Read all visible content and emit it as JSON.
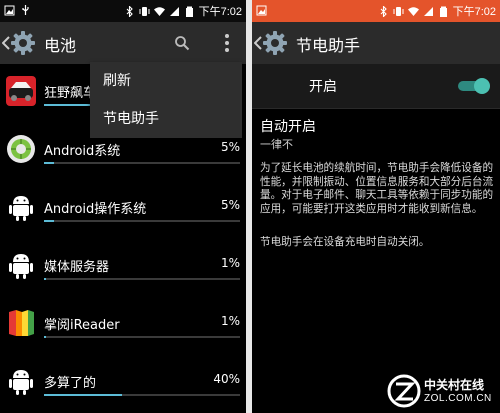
{
  "status_bar": {
    "time": "下午7:02"
  },
  "left_screen": {
    "title": "电池",
    "menu": {
      "items": [
        {
          "label": "刷新"
        },
        {
          "label": "节电助手"
        }
      ]
    },
    "apps": [
      {
        "label": "狂野飙车",
        "percent": "",
        "usage": 0.34,
        "icon": "asphalt-game-icon"
      },
      {
        "label": "Android系统",
        "percent": "5%",
        "usage": 0.05,
        "icon": "android-system-icon"
      },
      {
        "label": "Android操作系统",
        "percent": "5%",
        "usage": 0.05,
        "icon": "android-robot-icon"
      },
      {
        "label": "媒体服务器",
        "percent": "1%",
        "usage": 0.01,
        "icon": "android-robot-icon"
      },
      {
        "label": "掌阅iReader",
        "percent": "1%",
        "usage": 0.01,
        "icon": "ireader-book-icon"
      },
      {
        "label": "多算了的",
        "percent": "40%",
        "usage": 0.4,
        "icon": "android-robot-icon"
      }
    ]
  },
  "right_screen": {
    "title": "节电助手",
    "toggle_label": "开启",
    "toggle_on": true,
    "auto_title": "自动开启",
    "auto_subtitle": "一律不",
    "description": "为了延长电池的续航时间，节电助手会降低设备的性能，并限制振动、位置信息服务和大部分后台流量。对于电子邮件、聊天工具等依赖于同步功能的应用，可能要打开这类应用时才能收到新信息。",
    "note": "节电助手会在设备充电时自动关闭。"
  },
  "watermark": {
    "cn": "中关村在线",
    "en": "ZOL.COM.CN"
  },
  "colors": {
    "accent": "#5cbbd6",
    "orange_status": "#e4542b",
    "switch": "#4cc0b2"
  }
}
